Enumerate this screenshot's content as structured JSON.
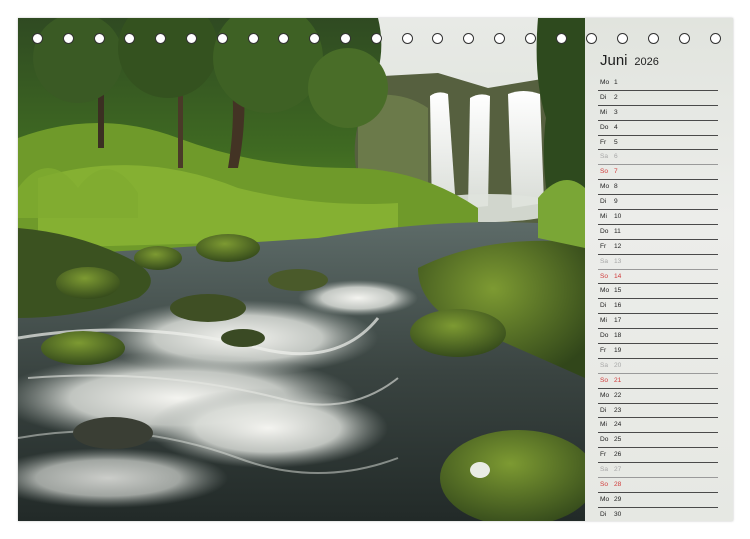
{
  "calendar": {
    "month": "Juni",
    "year": "2026",
    "days": [
      {
        "wd": "Mo",
        "d": "1",
        "type": "week"
      },
      {
        "wd": "Di",
        "d": "2",
        "type": "week"
      },
      {
        "wd": "Mi",
        "d": "3",
        "type": "week"
      },
      {
        "wd": "Do",
        "d": "4",
        "type": "week"
      },
      {
        "wd": "Fr",
        "d": "5",
        "type": "week"
      },
      {
        "wd": "Sa",
        "d": "6",
        "type": "sat"
      },
      {
        "wd": "So",
        "d": "7",
        "type": "sun"
      },
      {
        "wd": "Mo",
        "d": "8",
        "type": "week"
      },
      {
        "wd": "Di",
        "d": "9",
        "type": "week"
      },
      {
        "wd": "Mi",
        "d": "10",
        "type": "week"
      },
      {
        "wd": "Do",
        "d": "11",
        "type": "week"
      },
      {
        "wd": "Fr",
        "d": "12",
        "type": "week"
      },
      {
        "wd": "Sa",
        "d": "13",
        "type": "sat"
      },
      {
        "wd": "So",
        "d": "14",
        "type": "sun"
      },
      {
        "wd": "Mo",
        "d": "15",
        "type": "week"
      },
      {
        "wd": "Di",
        "d": "16",
        "type": "week"
      },
      {
        "wd": "Mi",
        "d": "17",
        "type": "week"
      },
      {
        "wd": "Do",
        "d": "18",
        "type": "week"
      },
      {
        "wd": "Fr",
        "d": "19",
        "type": "week"
      },
      {
        "wd": "Sa",
        "d": "20",
        "type": "sat"
      },
      {
        "wd": "So",
        "d": "21",
        "type": "sun"
      },
      {
        "wd": "Mo",
        "d": "22",
        "type": "week"
      },
      {
        "wd": "Di",
        "d": "23",
        "type": "week"
      },
      {
        "wd": "Mi",
        "d": "24",
        "type": "week"
      },
      {
        "wd": "Do",
        "d": "25",
        "type": "week"
      },
      {
        "wd": "Fr",
        "d": "26",
        "type": "week"
      },
      {
        "wd": "Sa",
        "d": "27",
        "type": "sat"
      },
      {
        "wd": "So",
        "d": "28",
        "type": "sun"
      },
      {
        "wd": "Mo",
        "d": "29",
        "type": "week"
      },
      {
        "wd": "Di",
        "d": "30",
        "type": "week"
      }
    ]
  },
  "colors": {
    "sunday": "#d13b3b",
    "saturday": "#a7a7a7",
    "text": "#222222"
  },
  "photo": {
    "subject": "waterfall-river-forest-photo",
    "binding_holes": 23
  }
}
